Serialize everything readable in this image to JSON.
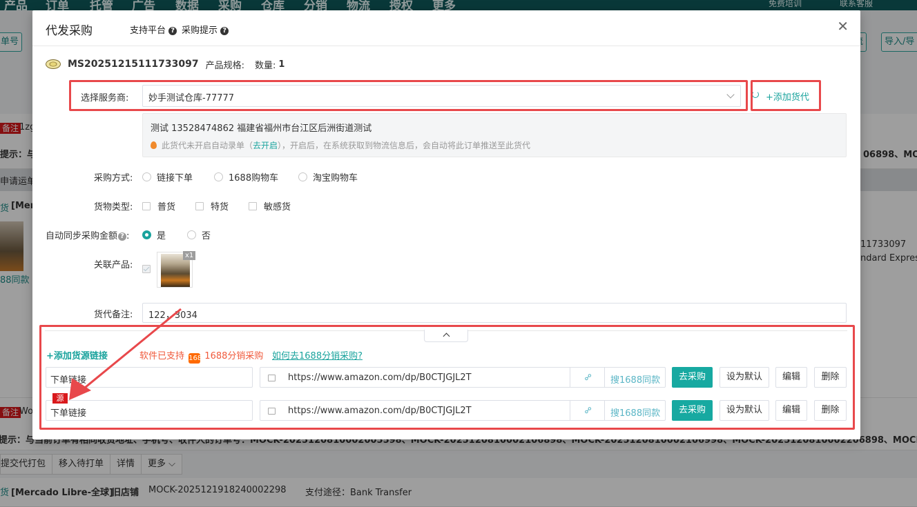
{
  "background": {
    "nav_items": [
      "产品",
      "订单",
      "托管",
      "广告",
      "数据",
      "采购",
      "仓库",
      "分销",
      "物流",
      "授权",
      "更多"
    ],
    "nav_right": [
      "免费培训",
      "联系客服"
    ],
    "left_button": "单号",
    "right_buttons": [
      "流",
      "导入/导"
    ],
    "row1_tag": "备注",
    "row1_text": "1zg",
    "hint1": "提示：与",
    "hint1_right": "06898、MO",
    "apply_link": "申请运单",
    "store_tag": "货",
    "store_name": "[Mer",
    "order_right": "11733097",
    "order_right2": "ndard Express",
    "same_link": "88同款",
    "row2_tag": "备注",
    "row2_text": "Wo",
    "hint2": "提示：与当前订单有相同收货地址、手机号、收件人的订单号：MOCK-2025120810002005598、MOCK-2025120810002106898、MOCK-2025120810002106998、MOCK-2025120810002206898、MOCK",
    "actions": [
      "提交代打包",
      "移入待打单",
      "详情",
      "更多 ⌵"
    ],
    "bottom_store_tag": "货",
    "bottom_store": "[Mercado Libre-全球]",
    "bottom_shop": "旧店铺",
    "bottom_order": "MOCK-2025121918240002298",
    "bottom_pay": "支付途径：Bank Transfer"
  },
  "modal": {
    "title": "代发采购",
    "support_platform": "支持平台",
    "purchase_tip": "采购提示",
    "order_no": "MS20251215111733097",
    "spec_label": "产品规格:",
    "qty_label": "数量:",
    "qty_value": "1",
    "provider_label": "选择服务商:",
    "provider_value": "妙手测试仓库-77777",
    "add_forwarder": "+添加货代",
    "address": "测试 13528474862 福建省福州市台江区后洲街道测试",
    "notice_prefix": "此货代未开启自动录单（",
    "notice_link": "去开启",
    "notice_suffix": "），开启后，在系统获取到物流信息后，会自动将此订单推送至此货代",
    "purchase_method_label": "采购方式:",
    "purchase_methods": [
      "链接下单",
      "1688购物车",
      "淘宝购物车"
    ],
    "goods_type_label": "货物类型:",
    "goods_types": [
      "普货",
      "特货",
      "敏感货"
    ],
    "auto_sync_label": "自动同步采购金额",
    "auto_sync_options": [
      "是",
      "否"
    ],
    "related_product_label": "关联产品:",
    "related_qty": "x1",
    "forwarder_note_label": "货代备注:",
    "forwarder_note_value": "122，3034",
    "add_source_link": "+添加货源链接",
    "software_support": "软件已支持",
    "ali_icon": "1688",
    "distribution": "1688分销采购",
    "howto_link": "如何去1688分销采购?",
    "sources": [
      {
        "name": "下单链接",
        "url": "https://www.amazon.com/dp/B0CTJGJL2T",
        "search": "搜1688同款",
        "buy": "去采购",
        "set_default": "设为默认",
        "edit": "编辑",
        "delete": "删除",
        "tag": ""
      },
      {
        "name": "下单链接",
        "url": "https://www.amazon.com/dp/B0CTJGJL2T",
        "search": "搜1688同款",
        "buy": "去采购",
        "set_default": "设为默认",
        "edit": "编辑",
        "delete": "删除",
        "tag": "源"
      }
    ]
  },
  "colors": {
    "accent": "#17a9a1",
    "nav_bg": "#0f5b5c",
    "highlight": "#e8484b",
    "tag_red": "#d9191c"
  }
}
